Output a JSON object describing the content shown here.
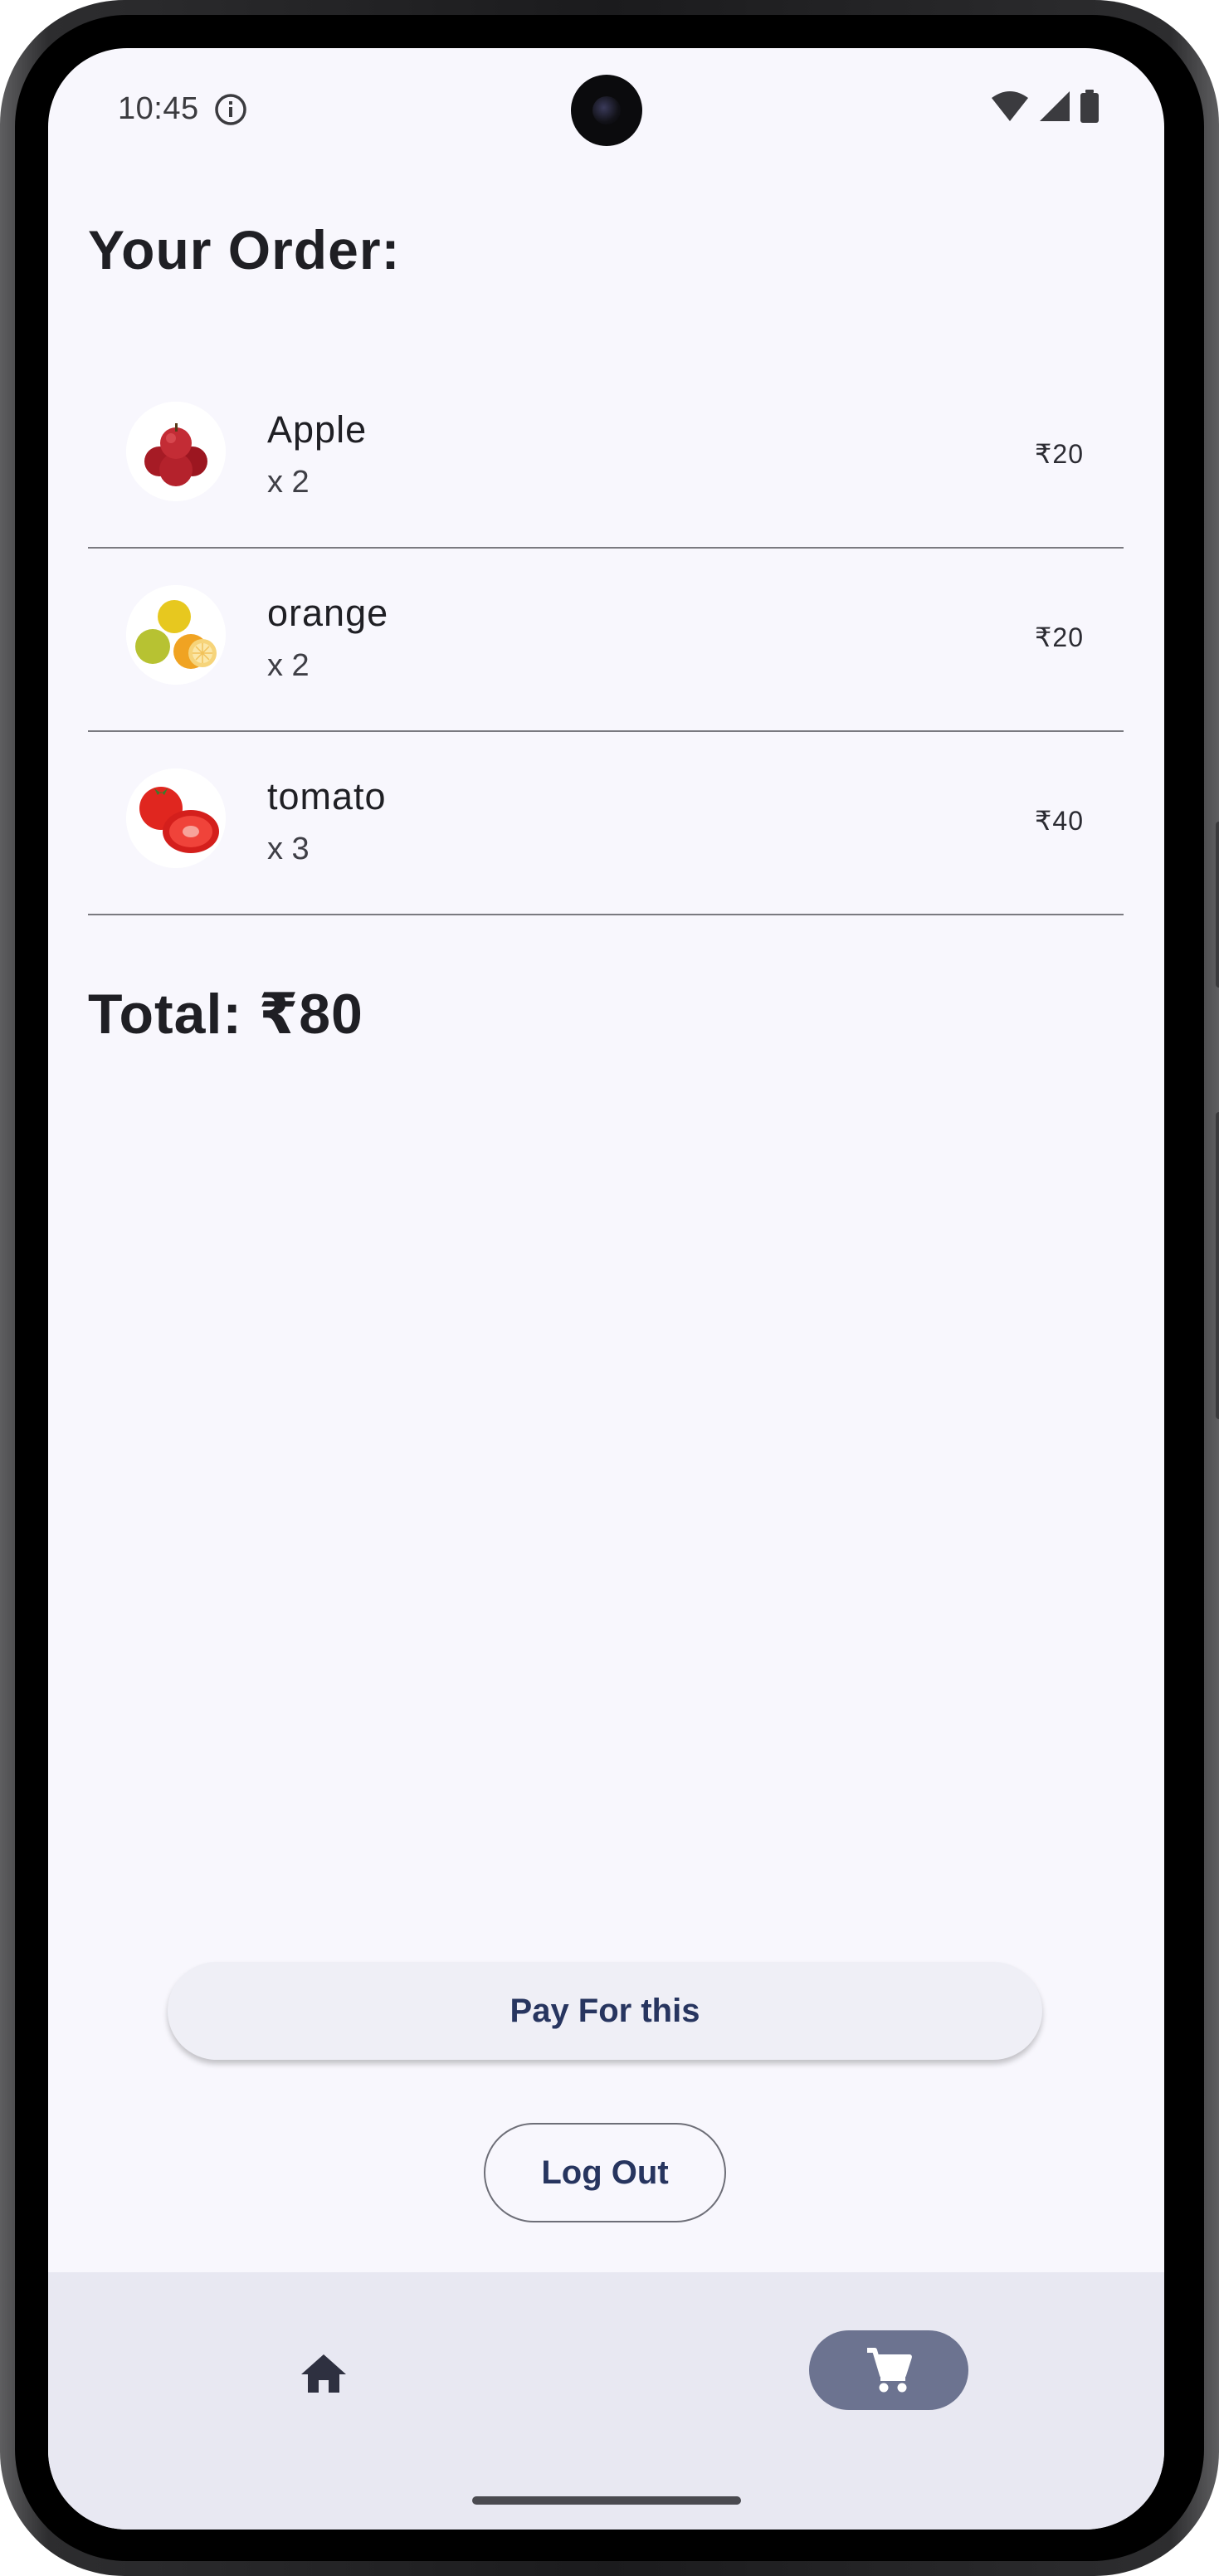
{
  "status_bar": {
    "time": "10:45",
    "icons": [
      "info-icon",
      "wifi-icon",
      "cellular-signal-icon",
      "battery-icon"
    ]
  },
  "page": {
    "title": "Your Order:"
  },
  "order": {
    "items": [
      {
        "name": "Apple",
        "quantity": "x 2",
        "price": "₹20",
        "image": "apple-image"
      },
      {
        "name": "orange",
        "quantity": "x 2",
        "price": "₹20",
        "image": "orange-image"
      },
      {
        "name": "tomato",
        "quantity": "x 3",
        "price": "₹40",
        "image": "tomato-image"
      }
    ],
    "total": "Total: ₹80"
  },
  "actions": {
    "pay_label": "Pay For this",
    "logout_label": "Log Out"
  },
  "bottom_nav": {
    "items": [
      {
        "icon": "home-icon",
        "selected": false
      },
      {
        "icon": "shopping-cart-icon",
        "selected": true
      }
    ]
  },
  "colors": {
    "background": "#f8f7fd",
    "nav_background": "#e8e8f2",
    "nav_selected_pill": "#6c7390",
    "button_text": "#27355f",
    "divider": "#7a7a80"
  }
}
